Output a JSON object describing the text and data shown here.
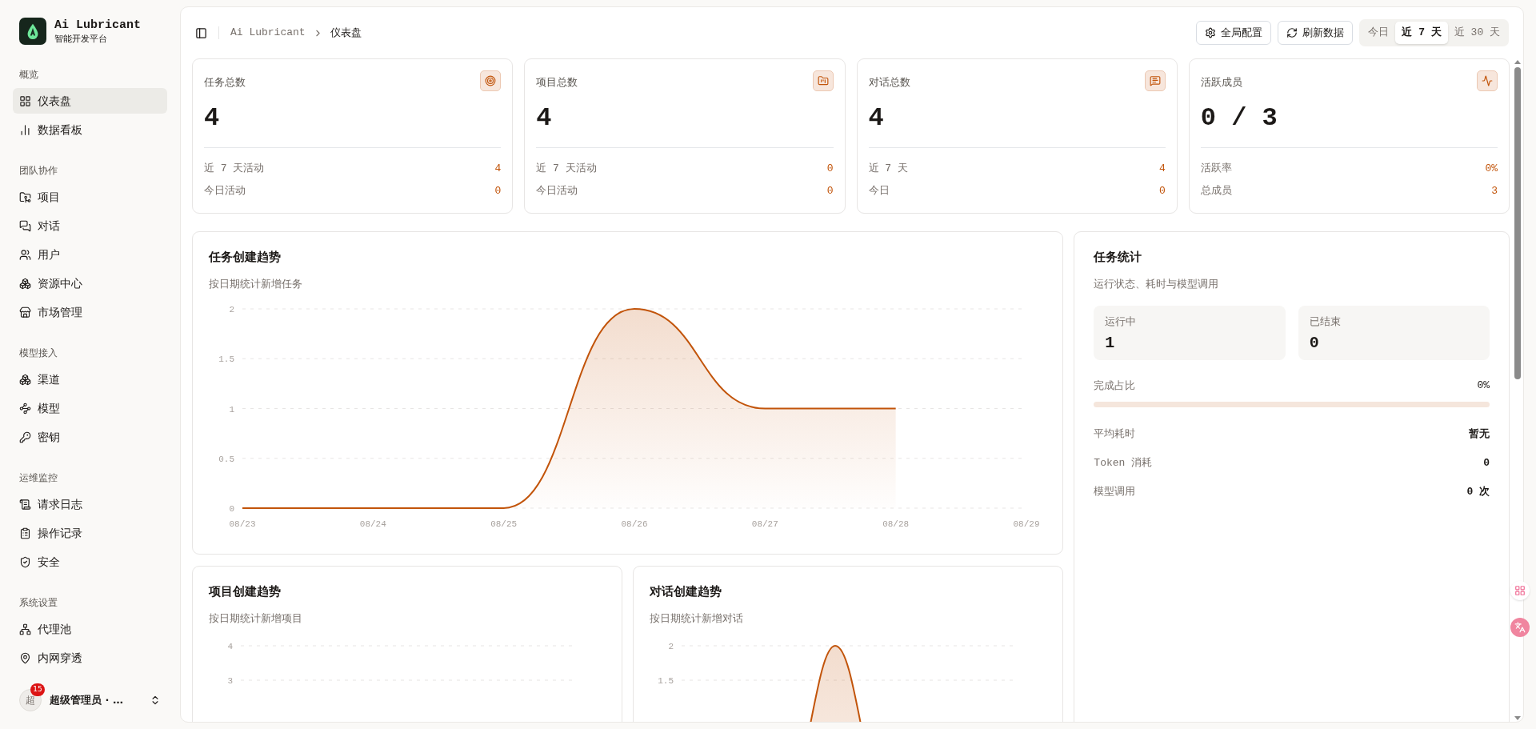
{
  "sidebar": {
    "brand": {
      "title": "Ai Lubricant",
      "subtitle": "智能开发平台"
    },
    "sections": [
      {
        "label": "概览",
        "items": [
          {
            "label": "仪表盘",
            "selected": true
          },
          {
            "label": "数据看板",
            "selected": false
          }
        ]
      },
      {
        "label": "团队协作",
        "items": [
          {
            "label": "项目",
            "selected": false
          },
          {
            "label": "对话",
            "selected": false
          },
          {
            "label": "用户",
            "selected": false
          },
          {
            "label": "资源中心",
            "selected": false
          },
          {
            "label": "市场管理",
            "selected": false
          }
        ]
      },
      {
        "label": "模型接入",
        "items": [
          {
            "label": "渠道",
            "selected": false
          },
          {
            "label": "模型",
            "selected": false
          },
          {
            "label": "密钥",
            "selected": false
          }
        ]
      },
      {
        "label": "运维监控",
        "items": [
          {
            "label": "请求日志",
            "selected": false
          },
          {
            "label": "操作记录",
            "selected": false
          },
          {
            "label": "安全",
            "selected": false
          }
        ]
      },
      {
        "label": "系统设置",
        "items": [
          {
            "label": "代理池",
            "selected": false
          },
          {
            "label": "内网穿透",
            "selected": false
          }
        ]
      }
    ],
    "user": {
      "avatar": "超",
      "badge": "15",
      "name": "超级管理员 · …"
    }
  },
  "header": {
    "breadcrumb": [
      "Ai Lubricant",
      "仪表盘"
    ],
    "buttons": [
      "全局配置",
      "刷新数据"
    ],
    "ranges": [
      {
        "label": "今日",
        "selected": false
      },
      {
        "label": "近 7 天",
        "selected": true
      },
      {
        "label": "近 30 天",
        "selected": false
      }
    ]
  },
  "stat_cards": [
    {
      "title": "任务总数",
      "value": "4",
      "rows": [
        {
          "label": "近 7 天活动",
          "value": "4"
        },
        {
          "label": "今日活动",
          "value": "0"
        }
      ]
    },
    {
      "title": "项目总数",
      "value": "4",
      "rows": [
        {
          "label": "近 7 天活动",
          "value": "0"
        },
        {
          "label": "今日活动",
          "value": "0"
        }
      ]
    },
    {
      "title": "对话总数",
      "value": "4",
      "rows": [
        {
          "label": "近 7 天",
          "value": "4"
        },
        {
          "label": "今日",
          "value": "0"
        }
      ]
    },
    {
      "title": "活跃成员",
      "value": "0 / 3",
      "rows": [
        {
          "label": "活跃率",
          "value": "0%"
        },
        {
          "label": "总成员",
          "value": "3"
        }
      ]
    }
  ],
  "task_trend": {
    "title": "任务创建趋势",
    "subtitle": "按日期统计新增任务",
    "chart_data": {
      "type": "area",
      "categories": [
        "08/23",
        "08/24",
        "08/25",
        "08/26",
        "08/27",
        "08/28",
        "08/29"
      ],
      "series": [
        {
          "color": "#c2540a",
          "values": [
            0,
            0,
            0,
            2,
            1,
            1,
            null
          ]
        }
      ],
      "ylim": [
        0,
        2
      ],
      "yticks": [
        0,
        0.5,
        1,
        1.5,
        2
      ],
      "grid": true
    }
  },
  "project_trend": {
    "title": "项目创建趋势",
    "subtitle": "按日期统计新增项目",
    "axis_labels": [
      "4",
      "3"
    ]
  },
  "conversation_trend": {
    "title": "对话创建趋势",
    "subtitle": "按日期统计新增对话",
    "axis_labels": [
      "2",
      "1.5"
    ]
  },
  "task_stats": {
    "title": "任务统计",
    "subtitle": "运行状态、耗时与模型调用",
    "tiles": [
      {
        "label": "运行中",
        "value": "1"
      },
      {
        "label": "已结束",
        "value": "0"
      }
    ],
    "completion": {
      "label": "完成占比",
      "value": "0%",
      "level": 0
    },
    "rows": [
      {
        "label": "平均耗时",
        "value": "暂无"
      },
      {
        "label": "Token 消耗",
        "value": "0"
      },
      {
        "label": "模型调用",
        "value": "0 次"
      }
    ]
  }
}
